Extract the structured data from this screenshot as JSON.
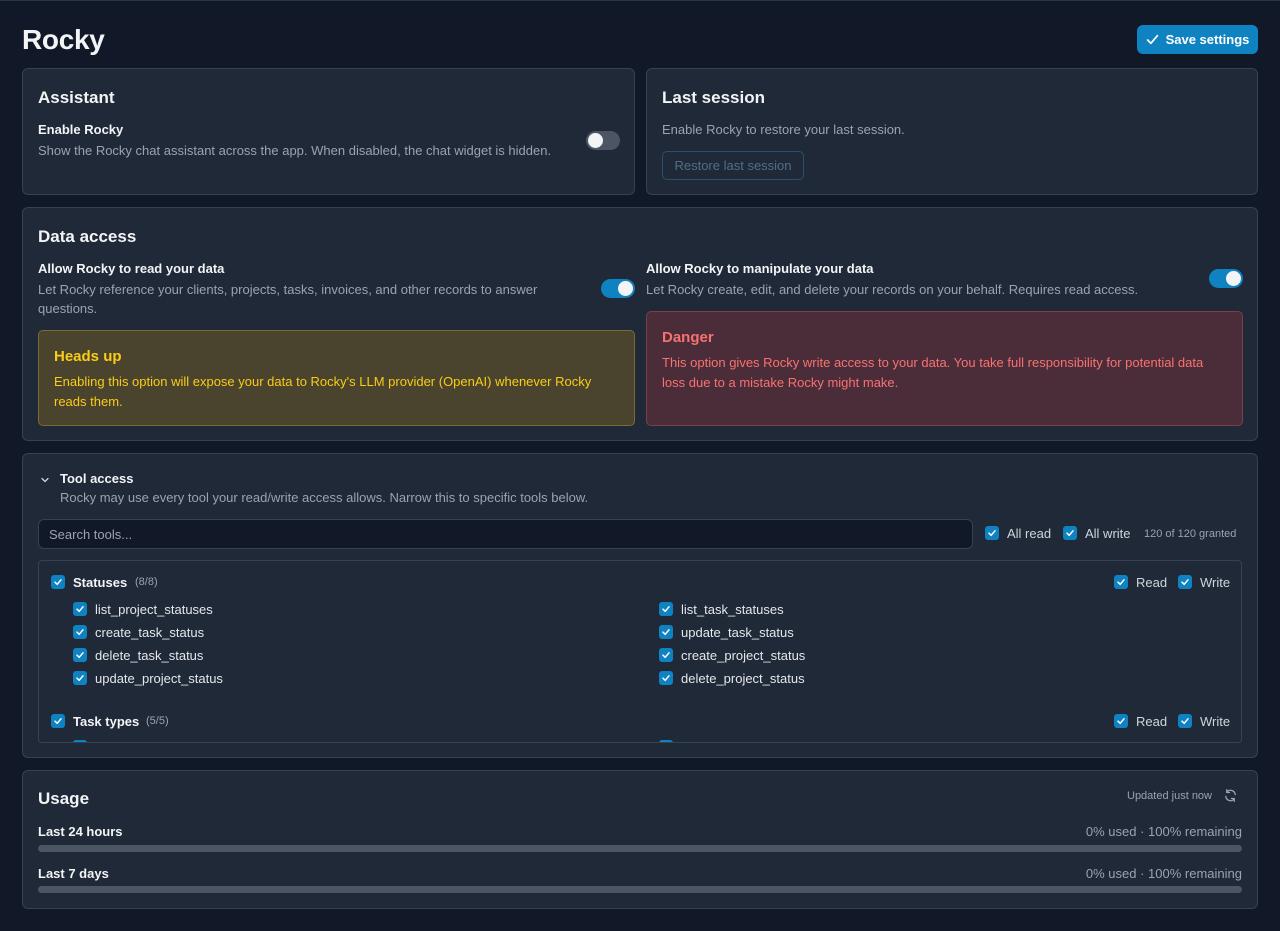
{
  "page": {
    "title": "Rocky",
    "save_label": "Save settings"
  },
  "assistant": {
    "title": "Assistant",
    "label": "Enable Rocky",
    "description": "Show the Rocky chat assistant across the app. When disabled, the chat widget is hidden.",
    "enabled": false
  },
  "last_session": {
    "title": "Last session",
    "description": "Enable Rocky to restore your last session.",
    "button_label": "Restore last session"
  },
  "data_access": {
    "title": "Data access",
    "read": {
      "label": "Allow Rocky to read your data",
      "description_line1": "Let Rocky reference your clients, projects, tasks, invoices, and other records to answer",
      "description_line2": "questions.",
      "enabled": true
    },
    "write": {
      "label": "Allow Rocky to manipulate your data",
      "description": "Let Rocky create, edit, and delete your records on your behalf. Requires read access.",
      "enabled": true
    },
    "warning": {
      "title": "Heads up",
      "line1": "Enabling this option will expose your data to Rocky's LLM provider (OpenAI) whenever Rocky",
      "line2": "reads them."
    },
    "danger": {
      "title": "Danger",
      "line1": "This option gives Rocky write access to your data. You take full responsibility for potential data",
      "line2": "loss due to a mistake Rocky might make."
    }
  },
  "tool_access": {
    "title": "Tool access",
    "description": "Rocky may use every tool your read/write access allows. Narrow this to specific tools below.",
    "search_placeholder": "Search tools...",
    "all_read_label": "All read",
    "all_write_label": "All write",
    "granted_label": "120 of 120 granted",
    "groups": [
      {
        "name": "Statuses",
        "count": "(8/8)",
        "read_label": "Read",
        "write_label": "Write",
        "tools": [
          "list_project_statuses",
          "list_task_statuses",
          "create_task_status",
          "update_task_status",
          "delete_task_status",
          "create_project_status",
          "update_project_status",
          "delete_project_status"
        ]
      },
      {
        "name": "Task types",
        "count": "(5/5)",
        "read_label": "Read",
        "write_label": "Write",
        "tools": []
      }
    ]
  },
  "usage": {
    "title": "Usage",
    "updated_label": "Updated just now",
    "rows": [
      {
        "label": "Last 24 hours",
        "value": "0% used · 100% remaining",
        "used_fraction": 0
      },
      {
        "label": "Last 7 days",
        "value": "0% used · 100% remaining",
        "used_fraction": 0
      }
    ]
  },
  "colors": {
    "accent": "#0f82c2",
    "background": "#111827",
    "card": "#1f2937",
    "warning": "#facc15",
    "danger": "#f87171"
  }
}
